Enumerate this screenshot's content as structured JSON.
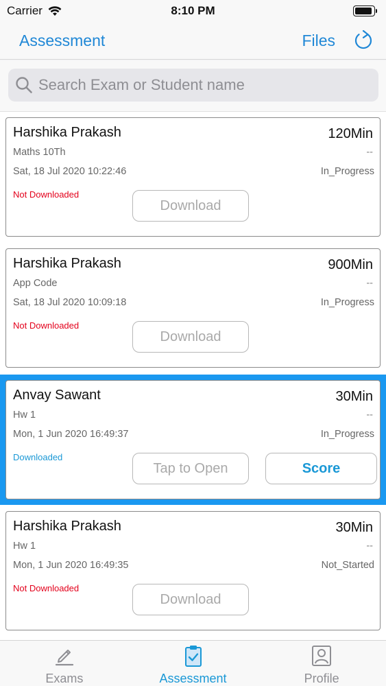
{
  "status_bar": {
    "carrier": "Carrier",
    "time": "8:10 PM"
  },
  "nav": {
    "title": "Assessment",
    "files_label": "Files",
    "refresh_icon": "refresh-icon"
  },
  "search": {
    "placeholder": "Search Exam or Student name",
    "value": ""
  },
  "cards": [
    {
      "name": "Harshika Prakash",
      "duration": "120Min",
      "subject": "Maths 10Th",
      "dash": "--",
      "date": "Sat, 18 Jul 2020 10:22:46",
      "state": "In_Progress",
      "download_status": "Not Downloaded",
      "primary_button": "Download",
      "selected": false
    },
    {
      "name": "Harshika Prakash",
      "duration": "900Min",
      "subject": "App Code",
      "dash": "--",
      "date": "Sat, 18 Jul 2020 10:09:18",
      "state": "In_Progress",
      "download_status": "Not Downloaded",
      "primary_button": "Download",
      "selected": false
    },
    {
      "name": "Anvay Sawant",
      "duration": "30Min",
      "subject": "Hw 1",
      "dash": "--",
      "date": "Mon, 1 Jun 2020 16:49:37",
      "state": "In_Progress",
      "download_status": "Downloaded",
      "primary_button": "Tap to Open",
      "score_button": "Score",
      "selected": true
    },
    {
      "name": "Harshika Prakash",
      "duration": "30Min",
      "subject": "Hw 1",
      "dash": "--",
      "date": "Mon, 1 Jun 2020 16:49:35",
      "state": "Not_Started",
      "download_status": "Not Downloaded",
      "primary_button": "Download",
      "selected": false
    }
  ],
  "tabs": [
    {
      "label": "Exams",
      "icon": "pencil-icon",
      "active": false
    },
    {
      "label": "Assessment",
      "icon": "clipboard-icon",
      "active": true
    },
    {
      "label": "Profile",
      "icon": "profile-icon",
      "active": false
    }
  ],
  "colors": {
    "accent": "#1a98d6",
    "nav_accent": "#1f87d6",
    "selection": "#1a98f0",
    "not_downloaded": "#e3001b"
  }
}
